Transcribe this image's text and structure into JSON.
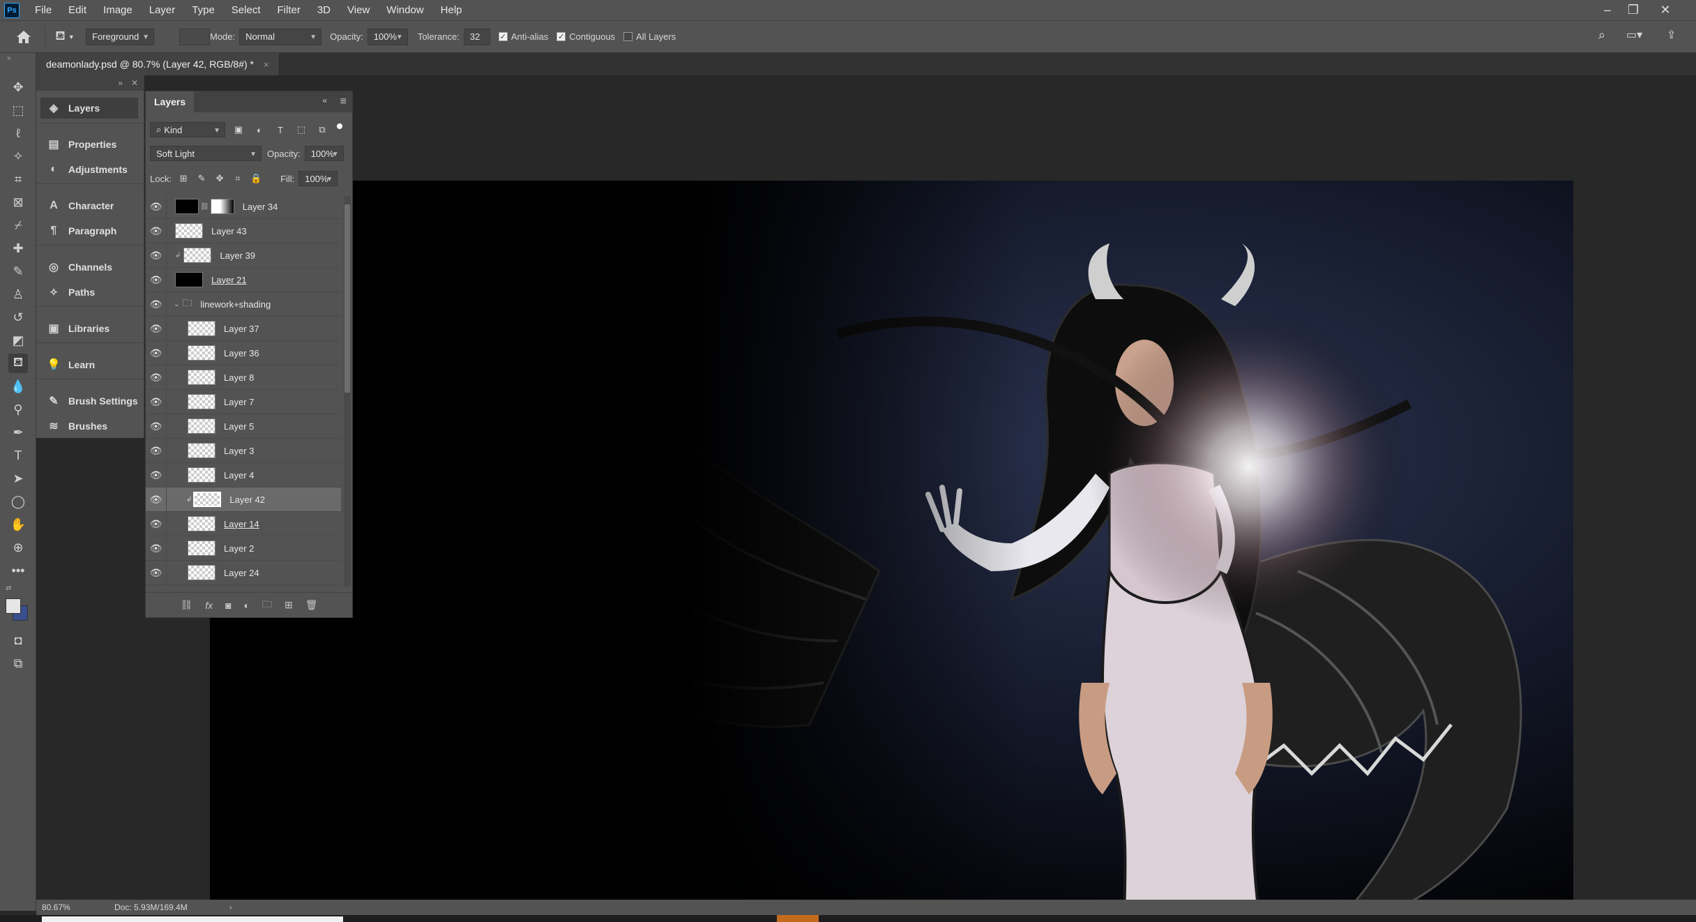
{
  "app": {
    "logo": "Ps"
  },
  "menu": [
    "File",
    "Edit",
    "Image",
    "Layer",
    "Type",
    "Select",
    "Filter",
    "3D",
    "View",
    "Window",
    "Help"
  ],
  "options": {
    "source": "Foreground",
    "mode_label": "Mode:",
    "mode": "Normal",
    "opacity_label": "Opacity:",
    "opacity": "100%",
    "tolerance_label": "Tolerance:",
    "tolerance": "32",
    "antialias": "Anti-alias",
    "contiguous": "Contiguous",
    "all_layers": "All Layers"
  },
  "document_tab": {
    "title": "deamonlady.psd @ 80.7% (Layer 42, RGB/8#) *",
    "close": "×"
  },
  "dock": [
    {
      "name": "layers",
      "label": "Layers",
      "icon": "layers-icon",
      "glyph": "◈"
    },
    {
      "name": "properties",
      "label": "Properties",
      "icon": "properties-icon",
      "glyph": "▤"
    },
    {
      "name": "adjustments",
      "label": "Adjustments",
      "icon": "adjustments-icon",
      "glyph": "◐"
    },
    {
      "name": "character",
      "label": "Character",
      "icon": "character-icon",
      "glyph": "A"
    },
    {
      "name": "paragraph",
      "label": "Paragraph",
      "icon": "paragraph-icon",
      "glyph": "¶"
    },
    {
      "name": "channels",
      "label": "Channels",
      "icon": "channels-icon",
      "glyph": "◎"
    },
    {
      "name": "paths",
      "label": "Paths",
      "icon": "paths-icon",
      "glyph": "⟡"
    },
    {
      "name": "libraries",
      "label": "Libraries",
      "icon": "libraries-icon",
      "glyph": "▣"
    },
    {
      "name": "learn",
      "label": "Learn",
      "icon": "learn-icon",
      "glyph": "💡"
    },
    {
      "name": "brush-settings",
      "label": "Brush Settings",
      "icon": "brush-settings-icon",
      "glyph": "✎"
    },
    {
      "name": "brushes",
      "label": "Brushes",
      "icon": "brushes-icon",
      "glyph": "≋"
    }
  ],
  "layers_panel": {
    "title": "Layers",
    "filter": "Kind",
    "blend_mode": "Soft Light",
    "opacity_label": "Opacity:",
    "opacity": "100%",
    "lock_label": "Lock:",
    "fill_label": "Fill:",
    "fill": "100%",
    "layers": [
      {
        "name": "Layer 34",
        "thumb": "black-mask",
        "indent": 0
      },
      {
        "name": "Layer 43",
        "thumb": "transparent",
        "indent": 0
      },
      {
        "name": "Layer 39",
        "thumb": "transparent",
        "indent": 0,
        "clipped": true
      },
      {
        "name": "Layer 21",
        "thumb": "black",
        "indent": 0
      },
      {
        "name": "linework+shading",
        "thumb": "folder",
        "indent": 0,
        "group": true
      },
      {
        "name": "Layer 37",
        "thumb": "transparent",
        "indent": 1
      },
      {
        "name": "Layer 36",
        "thumb": "transparent",
        "indent": 1
      },
      {
        "name": "Layer 8",
        "thumb": "transparent",
        "indent": 1
      },
      {
        "name": "Layer 7",
        "thumb": "transparent",
        "indent": 1
      },
      {
        "name": "Layer 5",
        "thumb": "transparent",
        "indent": 1
      },
      {
        "name": "Layer 3",
        "thumb": "transparent",
        "indent": 1
      },
      {
        "name": "Layer 4",
        "thumb": "transparent",
        "indent": 1
      },
      {
        "name": "Layer 42",
        "thumb": "transparent",
        "indent": 1,
        "selected": true,
        "clipped": true
      },
      {
        "name": "Layer 14",
        "thumb": "transparent",
        "indent": 1
      },
      {
        "name": "Layer 2",
        "thumb": "transparent",
        "indent": 1
      },
      {
        "name": "Layer 24",
        "thumb": "transparent",
        "indent": 1
      }
    ]
  },
  "status": {
    "zoom": "80.67%",
    "doc": "Doc: 5.93M/169.4M"
  }
}
